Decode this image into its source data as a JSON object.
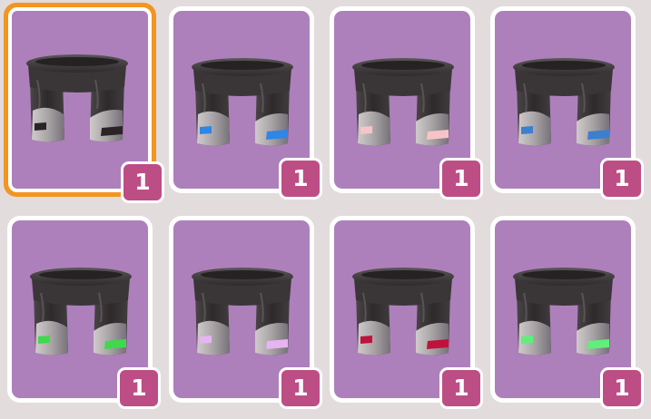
{
  "colors": {
    "background": "#e2dcdd",
    "card_inner": "#ad80bc",
    "card_border": "#ffffff",
    "selected_border": "#f3951f",
    "badge": "#bd4e85",
    "badge_text": "#ffffff",
    "shorts_body": "#3e3a3b",
    "shorts_cuff": "#a5a0a1"
  },
  "inventory": {
    "items": [
      {
        "name": "shorts-black-stripe",
        "icon": "shorts-icon",
        "stripe_color": "#2b2426",
        "count": "1",
        "selected": true
      },
      {
        "name": "shorts-blue-stripe",
        "icon": "shorts-icon",
        "stripe_color": "#2e86e8",
        "count": "1",
        "selected": false
      },
      {
        "name": "shorts-pink-stripe",
        "icon": "shorts-icon",
        "stripe_color": "#f6c4c6",
        "count": "1",
        "selected": false
      },
      {
        "name": "shorts-steel-blue-stripe",
        "icon": "shorts-icon",
        "stripe_color": "#3d7fcf",
        "count": "1",
        "selected": false
      },
      {
        "name": "shorts-green-stripe",
        "icon": "shorts-icon",
        "stripe_color": "#3fd94e",
        "count": "1",
        "selected": false
      },
      {
        "name": "shorts-lavender-stripe",
        "icon": "shorts-icon",
        "stripe_color": "#e6b4f0",
        "count": "1",
        "selected": false
      },
      {
        "name": "shorts-crimson-stripe",
        "icon": "shorts-icon",
        "stripe_color": "#c0123b",
        "count": "1",
        "selected": false
      },
      {
        "name": "shorts-mint-stripe",
        "icon": "shorts-icon",
        "stripe_color": "#5ef07a",
        "count": "1",
        "selected": false
      }
    ]
  }
}
